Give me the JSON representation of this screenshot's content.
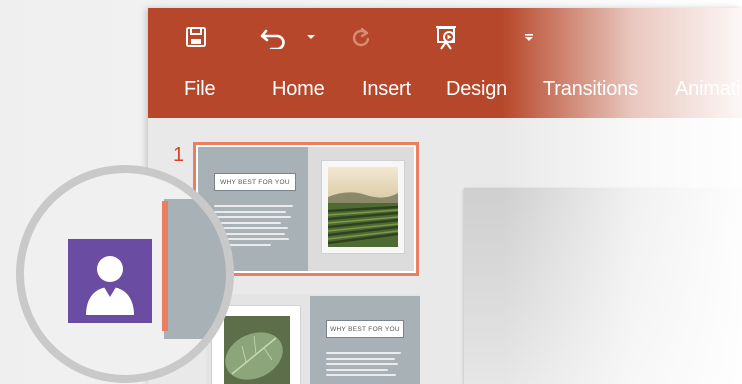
{
  "ribbon": {
    "color": "#b7472a",
    "quick_access": [
      {
        "icon": "save-icon"
      },
      {
        "icon": "undo-icon"
      },
      {
        "icon": "undo-dropdown-icon"
      },
      {
        "icon": "redo-icon"
      },
      {
        "icon": "present-from-beginning-icon"
      },
      {
        "icon": "customize-quick-access-icon"
      }
    ],
    "tabs": [
      "File",
      "Home",
      "Insert",
      "Design",
      "Transitions",
      "Animati"
    ]
  },
  "slides_pane": {
    "accent_color": "#e97e60",
    "slides": [
      {
        "number": "1",
        "title": "WHY BEST FOR YOU"
      },
      {
        "number": "",
        "title": "WHY BEST FOR YOU"
      }
    ]
  },
  "avatar": {
    "tile_color": "#6a4ca2",
    "icon": "user-icon"
  }
}
